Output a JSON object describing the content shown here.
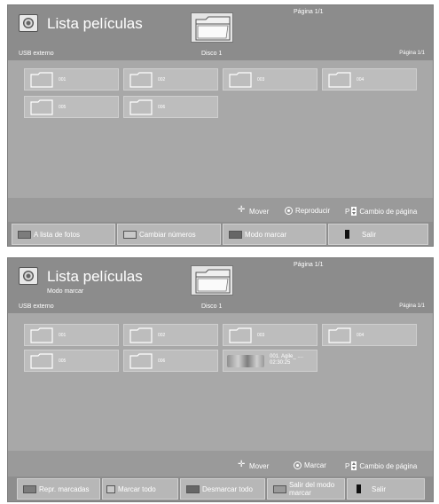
{
  "screen1": {
    "title": "Lista películas",
    "page_top": "Página 1/1",
    "location": "USB externo",
    "disk": "Disco 1",
    "page_right": "Página 1/1",
    "folders": [
      {
        "label": "001"
      },
      {
        "label": "002"
      },
      {
        "label": "003"
      },
      {
        "label": "004"
      },
      {
        "label": "005"
      },
      {
        "label": "006"
      }
    ],
    "hints": {
      "move": "Mover",
      "play": "Reproducir",
      "page_key": "P",
      "page_change": "Cambio de página"
    },
    "buttons": {
      "photo_list": "A lista de fotos",
      "change_numbers": "Cambiar números",
      "mark_mode": "Modo marcar",
      "exit": "Salir"
    }
  },
  "screen2": {
    "title": "Lista películas",
    "subtitle": "Modo marcar",
    "page_top": "Página 1/1",
    "location": "USB externo",
    "disk": "Disco 1",
    "page_right": "Página 1/1",
    "folders": [
      {
        "label": "001"
      },
      {
        "label": "002"
      },
      {
        "label": "003"
      },
      {
        "label": "004"
      },
      {
        "label": "005"
      },
      {
        "label": "006"
      }
    ],
    "video": {
      "name": "001. Agile_ ....",
      "duration": "02:30:25"
    },
    "hints": {
      "move": "Mover",
      "mark": "Marcar",
      "page_key": "P",
      "page_change": "Cambio de página"
    },
    "buttons": {
      "play_marked": "Repr. marcadas",
      "mark_all": "Marcar todo",
      "unmark_all": "Desmarcar todo",
      "exit_mark_mode": "Salir del modo marcar",
      "exit": "Salir"
    }
  },
  "colors": {
    "panel": "#9a9a9a",
    "header": "#8c8c8c",
    "tile": "#bdbdbd",
    "text": "#ffffff"
  }
}
